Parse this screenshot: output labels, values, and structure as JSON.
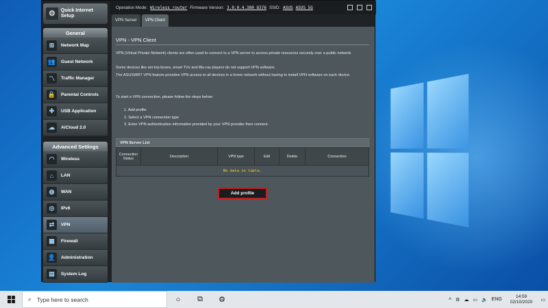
{
  "router": {
    "topbar": {
      "op_mode_label": "Operation Mode:",
      "op_mode_value": "Wireless router",
      "firmware_label": "Firmware Version:",
      "firmware_value": "3.0.0.4.380_8376",
      "ssid_label": "SSID:",
      "ssid_values": [
        "ASUS",
        "ASUS_5G"
      ]
    },
    "sidebar": {
      "quick_setup": "Quick Internet Setup",
      "general_header": "General",
      "general_items": [
        {
          "label": "Network Map",
          "icon": "network-map-icon"
        },
        {
          "label": "Guest Network",
          "icon": "guest-network-icon"
        },
        {
          "label": "Traffic Manager",
          "icon": "traffic-manager-icon"
        },
        {
          "label": "Parental Controls",
          "icon": "parental-controls-icon"
        },
        {
          "label": "USB Application",
          "icon": "usb-icon"
        },
        {
          "label": "AiCloud 2.0",
          "icon": "cloud-icon"
        }
      ],
      "advanced_header": "Advanced Settings",
      "advanced_items": [
        {
          "label": "Wireless",
          "icon": "wifi-icon"
        },
        {
          "label": "LAN",
          "icon": "lan-icon"
        },
        {
          "label": "WAN",
          "icon": "globe-icon"
        },
        {
          "label": "IPv6",
          "icon": "ipv6-icon"
        },
        {
          "label": "VPN",
          "icon": "vpn-icon",
          "active": true
        },
        {
          "label": "Firewall",
          "icon": "firewall-icon"
        },
        {
          "label": "Administration",
          "icon": "administration-icon"
        },
        {
          "label": "System Log",
          "icon": "system-log-icon"
        }
      ]
    },
    "tabs": [
      "VPN Server",
      "VPN Client"
    ],
    "active_tab": "VPN Client",
    "content": {
      "title": "VPN - VPN Client",
      "description": [
        "VPN (Virtual Private Network) clients are often used to connect to a VPN server to access private resources securely over a public network.",
        "Some devices like set-top boxes, smart TVs and Blu-ray players do not support VPN software.",
        "The ASUSWRT VPN feature provides VPN access to all devices in a home network without having to install VPN software on each device."
      ],
      "steps_intro": "To start a VPN connection, please follow the steps below:",
      "steps": [
        "1. Add profile",
        "2. Select a VPN connection type",
        "3. Enter VPN authentication information provided by your VPN provider then connect."
      ],
      "list_title": "VPN Server List",
      "columns": [
        "Connection Status",
        "Description",
        "VPN type",
        "Edit",
        "Delete",
        "Connection"
      ],
      "empty_text": "No data in table.",
      "add_button": "Add profile"
    }
  },
  "taskbar": {
    "search_placeholder": "Type here to search",
    "language": "ENG",
    "time": "14:59",
    "date": "02/10/2020"
  },
  "colors": {
    "accent_red": "#c4201e",
    "empty_text": "#ffd21e",
    "desktop_blue": "#0f5cb5"
  }
}
